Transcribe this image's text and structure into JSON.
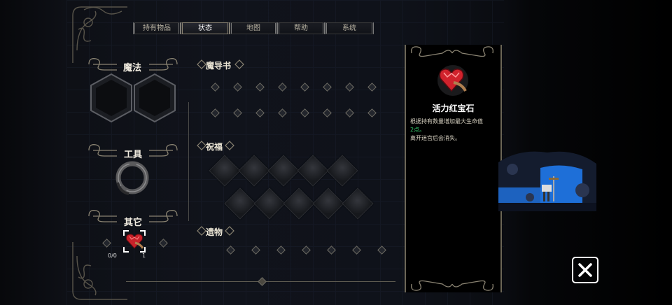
{
  "tabs": [
    {
      "label": "持有物品"
    },
    {
      "label": "状态"
    },
    {
      "label": "地图"
    },
    {
      "label": "帮助"
    },
    {
      "label": "系统"
    }
  ],
  "active_tab": "状态",
  "left_sections": {
    "magic": "魔法",
    "tools": "工具",
    "other": "其它"
  },
  "right_sections": {
    "grimoire": "魔导书",
    "blessing": "祝福",
    "relic": "遗物"
  },
  "other_item": {
    "count": "0/0",
    "quantity": "1",
    "icon": "ruby-heart-icon"
  },
  "detail": {
    "name": "活力红宝石",
    "desc_line1": "根据持有数量增加最大生命值",
    "desc_accent": "2点。",
    "desc_line2": "离开迷宫后会消失。",
    "icon": "ruby-heart-icon"
  },
  "close_icon": "close-icon",
  "colors": {
    "accent_green": "#35c86a",
    "ornament": "#8a8372"
  }
}
